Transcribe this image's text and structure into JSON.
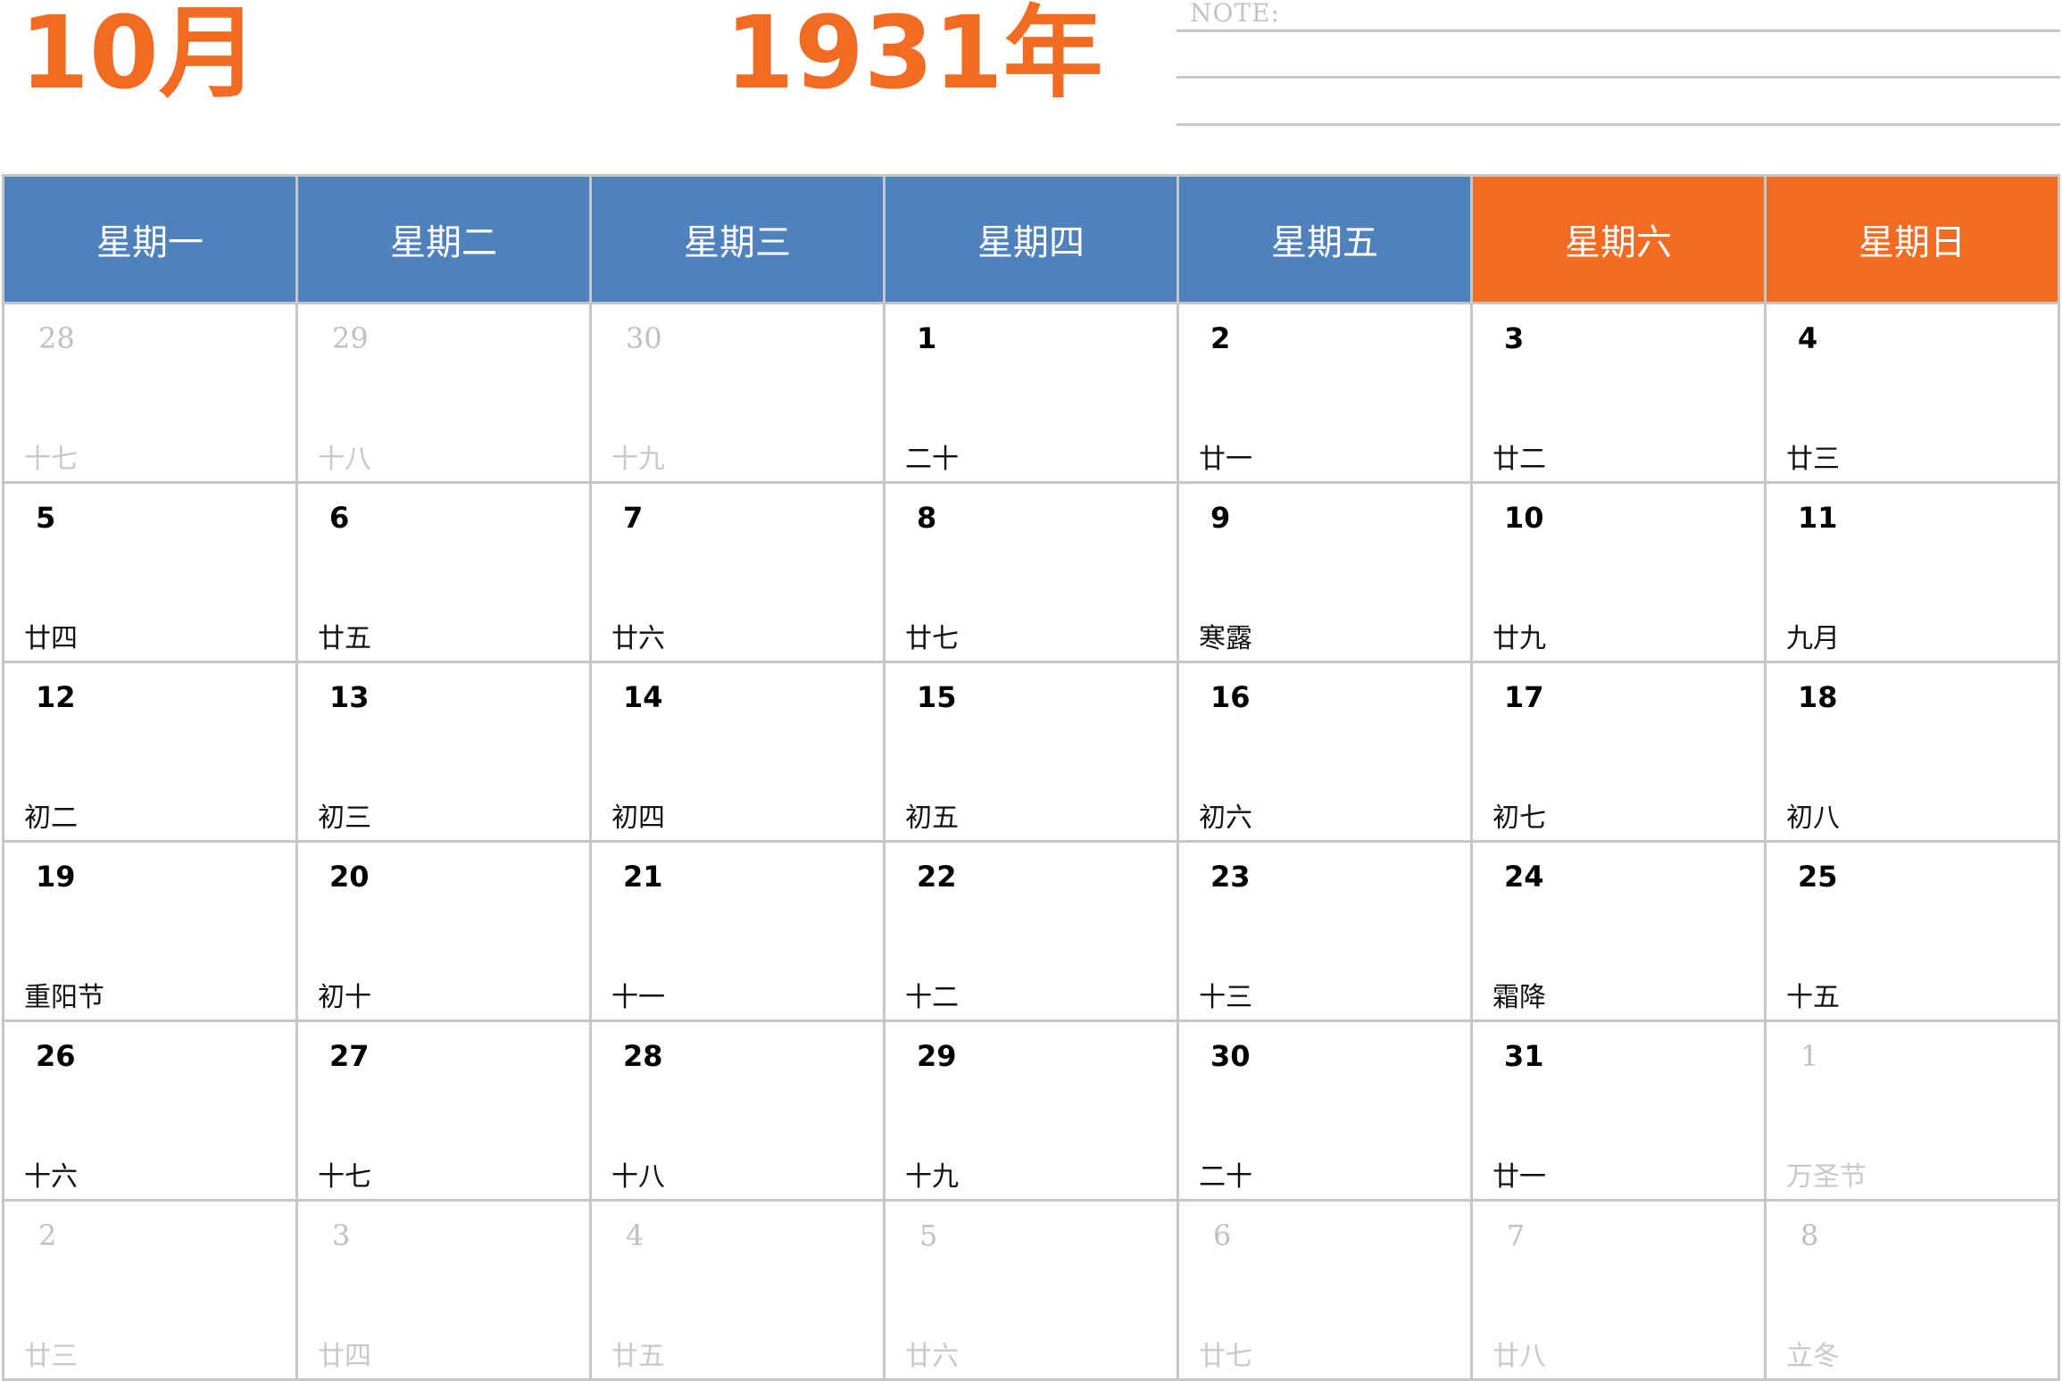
{
  "header": {
    "month": "10月",
    "year": "1931年",
    "note_label": "NOTE:"
  },
  "colors": {
    "accent_orange": "#f26b22",
    "weekday_blue": "#4f81bd",
    "grid_line": "#c6c6c6",
    "muted_text": "#c0c0c0"
  },
  "weekdays": [
    "星期一",
    "星期二",
    "星期三",
    "星期四",
    "星期五",
    "星期六",
    "星期日"
  ],
  "weeks": [
    [
      {
        "day": "28",
        "lunar": "十七",
        "current": false
      },
      {
        "day": "29",
        "lunar": "十八",
        "current": false
      },
      {
        "day": "30",
        "lunar": "十九",
        "current": false
      },
      {
        "day": "1",
        "lunar": "二十",
        "current": true
      },
      {
        "day": "2",
        "lunar": "廿一",
        "current": true
      },
      {
        "day": "3",
        "lunar": "廿二",
        "current": true
      },
      {
        "day": "4",
        "lunar": "廿三",
        "current": true
      }
    ],
    [
      {
        "day": "5",
        "lunar": "廿四",
        "current": true
      },
      {
        "day": "6",
        "lunar": "廿五",
        "current": true
      },
      {
        "day": "7",
        "lunar": "廿六",
        "current": true
      },
      {
        "day": "8",
        "lunar": "廿七",
        "current": true
      },
      {
        "day": "9",
        "lunar": "寒露",
        "current": true
      },
      {
        "day": "10",
        "lunar": "廿九",
        "current": true
      },
      {
        "day": "11",
        "lunar": "九月",
        "current": true
      }
    ],
    [
      {
        "day": "12",
        "lunar": "初二",
        "current": true
      },
      {
        "day": "13",
        "lunar": "初三",
        "current": true
      },
      {
        "day": "14",
        "lunar": "初四",
        "current": true
      },
      {
        "day": "15",
        "lunar": "初五",
        "current": true
      },
      {
        "day": "16",
        "lunar": "初六",
        "current": true
      },
      {
        "day": "17",
        "lunar": "初七",
        "current": true
      },
      {
        "day": "18",
        "lunar": "初八",
        "current": true
      }
    ],
    [
      {
        "day": "19",
        "lunar": "重阳节",
        "current": true
      },
      {
        "day": "20",
        "lunar": "初十",
        "current": true
      },
      {
        "day": "21",
        "lunar": "十一",
        "current": true
      },
      {
        "day": "22",
        "lunar": "十二",
        "current": true
      },
      {
        "day": "23",
        "lunar": "十三",
        "current": true
      },
      {
        "day": "24",
        "lunar": "霜降",
        "current": true
      },
      {
        "day": "25",
        "lunar": "十五",
        "current": true
      }
    ],
    [
      {
        "day": "26",
        "lunar": "十六",
        "current": true
      },
      {
        "day": "27",
        "lunar": "十七",
        "current": true
      },
      {
        "day": "28",
        "lunar": "十八",
        "current": true
      },
      {
        "day": "29",
        "lunar": "十九",
        "current": true
      },
      {
        "day": "30",
        "lunar": "二十",
        "current": true
      },
      {
        "day": "31",
        "lunar": "廿一",
        "current": true
      },
      {
        "day": "1",
        "lunar": "万圣节",
        "current": false
      }
    ],
    [
      {
        "day": "2",
        "lunar": "廿三",
        "current": false
      },
      {
        "day": "3",
        "lunar": "廿四",
        "current": false
      },
      {
        "day": "4",
        "lunar": "廿五",
        "current": false
      },
      {
        "day": "5",
        "lunar": "廿六",
        "current": false
      },
      {
        "day": "6",
        "lunar": "廿七",
        "current": false
      },
      {
        "day": "7",
        "lunar": "廿八",
        "current": false
      },
      {
        "day": "8",
        "lunar": "立冬",
        "current": false
      }
    ]
  ]
}
